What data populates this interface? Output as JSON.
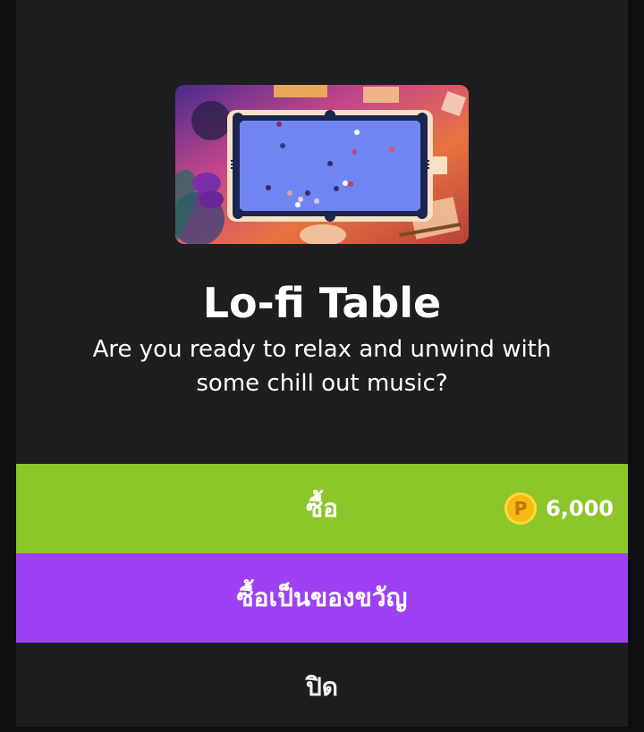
{
  "product": {
    "title": "Lo-fi Table",
    "description": "Are you ready to relax and unwind with some chill out music?",
    "image": "pool-table-lofi-artwork"
  },
  "buttons": {
    "buy_label": "ซื้อ",
    "price": "6,000",
    "coin_symbol": "P",
    "gift_label": "ซื้อเป็นของขวัญ",
    "close_label": "ปิด"
  },
  "colors": {
    "background": "#1e1e20",
    "buy": "#8cc62b",
    "gift": "#9d41f2",
    "coin": "#f7b90f"
  }
}
